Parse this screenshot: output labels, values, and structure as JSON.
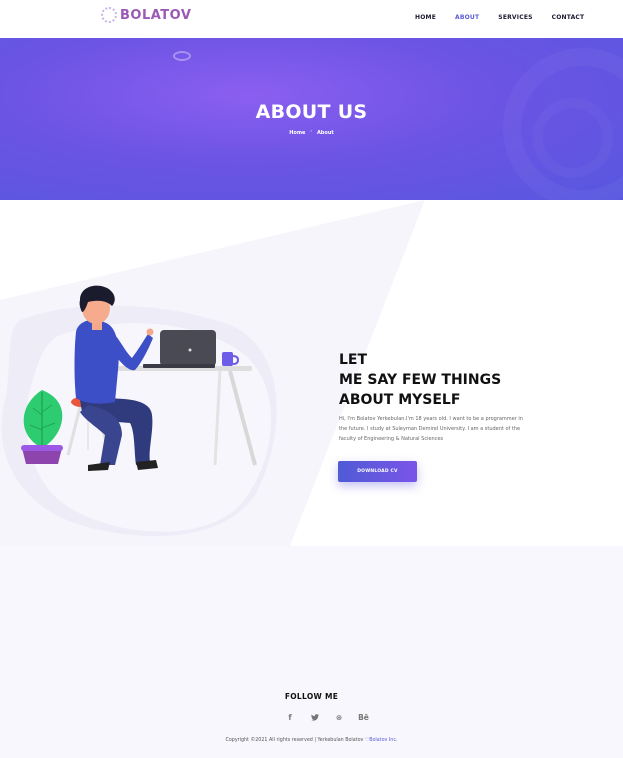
{
  "brand": {
    "name": "BOLATOV",
    "accent": "#9b59b6"
  },
  "nav": {
    "items": [
      {
        "label": "HOME",
        "active": false
      },
      {
        "label": "ABOUT",
        "active": true
      },
      {
        "label": "SERVICES",
        "active": false
      },
      {
        "label": "CONTACT",
        "active": false
      }
    ],
    "active_color": "#5b5bd6"
  },
  "hero": {
    "title": "ABOUT US",
    "breadcrumb": {
      "home": "Home",
      "separator": "˃",
      "current": "About"
    },
    "gradient": [
      "#8b5ff0",
      "#5757df"
    ]
  },
  "about": {
    "heading_lines": [
      "LET",
      "ME SAY FEW THINGS",
      "ABOUT MYSELF"
    ],
    "text": "Hi, I'm Bolatov Yerkebulan.I'm 18 years old. I want to be a programmer in the future. I study at Suleyman Demirel University. I am a student of the faculty of Engineering & Natural Sciences",
    "button_label": "DOWNLOAD CV",
    "button_colors": [
      "#4f5bd5",
      "#7a55e8"
    ]
  },
  "footer": {
    "follow_title": "FOLLOW ME",
    "social_icons": [
      {
        "icon": "facebook-icon",
        "glyph": "f"
      },
      {
        "icon": "twitter-icon",
        "glyph": "🐦"
      },
      {
        "icon": "dribbble-icon",
        "glyph": "⊛"
      },
      {
        "icon": "behance-icon",
        "glyph": "Bē"
      }
    ],
    "copyright_prefix": "Copyright ©2021 All rights reserved | Yerkebulan Bolatov ",
    "heart": "♡",
    "copyright_brand": "Bolatov Inc."
  }
}
